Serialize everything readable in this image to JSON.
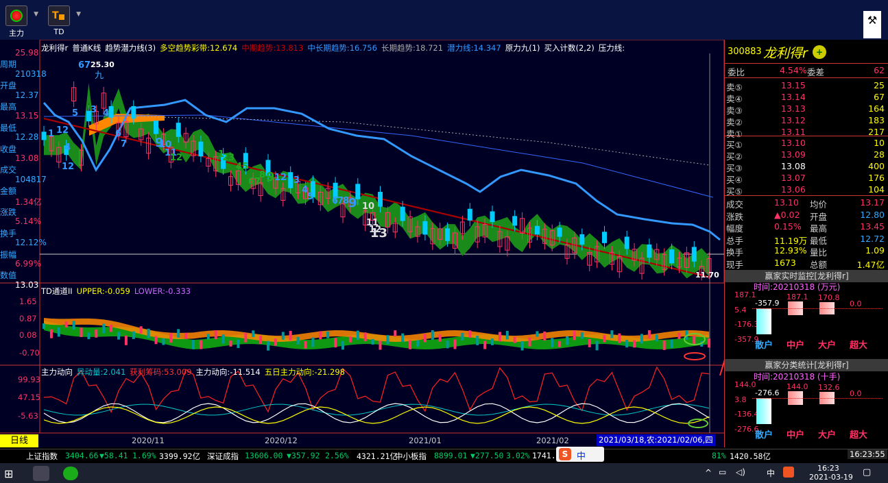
{
  "toolbar": {
    "btn1": "主力",
    "btn2": "TD"
  },
  "legend_main": [
    {
      "t": "龙利得r",
      "c": "#fff"
    },
    {
      "t": "普通K线",
      "c": "#fff"
    },
    {
      "t": "趋势潜力线(3)",
      "c": "#fff"
    },
    {
      "t": "多空趋势彩带:12.674",
      "c": "#ff0"
    },
    {
      "t": "中期趋势:13.813",
      "c": "#c00"
    },
    {
      "t": "中长期趋势:16.756",
      "c": "#39f"
    },
    {
      "t": "长期趋势:18.721",
      "c": "#aaa"
    },
    {
      "t": "潜力线:14.347",
      "c": "#39f"
    },
    {
      "t": "原力九(1)",
      "c": "#fff"
    },
    {
      "t": "买入计数(2,2)",
      "c": "#fff"
    },
    {
      "t": "压力线:",
      "c": "#fff"
    }
  ],
  "legend_td": [
    {
      "t": "TD通道II",
      "c": "#fff"
    },
    {
      "t": "UPPER:-0.059",
      "c": "#ff0"
    },
    {
      "t": "LOWER:-0.333",
      "c": "#c6f"
    }
  ],
  "legend_zl": [
    {
      "t": "主力动向",
      "c": "#fff"
    },
    {
      "t": "异动量:2.041",
      "c": "#0cc"
    },
    {
      "t": "获利筹码:53.009",
      "c": "#f33"
    },
    {
      "t": "主力动向:-11.514",
      "c": "#fff"
    },
    {
      "t": "五日主力动向:-21.298",
      "c": "#ff0"
    }
  ],
  "left_labels": [
    {
      "t": "25.98",
      "c": "#f36"
    },
    {
      "t": "周期",
      "c": "#3af"
    },
    {
      "t": "210318",
      "c": "#3af"
    },
    {
      "t": "开盘",
      "c": "#3af"
    },
    {
      "t": "12.37",
      "c": "#3af"
    },
    {
      "t": "最高",
      "c": "#3af"
    },
    {
      "t": "13.15",
      "c": "#f36"
    },
    {
      "t": "最低",
      "c": "#3af"
    },
    {
      "t": "12.28",
      "c": "#3af"
    },
    {
      "t": "收盘",
      "c": "#3af"
    },
    {
      "t": "13.08",
      "c": "#f36"
    },
    {
      "t": "成交",
      "c": "#3af"
    },
    {
      "t": "104817",
      "c": "#3af"
    },
    {
      "t": "金额",
      "c": "#3af"
    },
    {
      "t": "1.34亿",
      "c": "#f36"
    },
    {
      "t": "涨跌",
      "c": "#3af"
    },
    {
      "t": "5.14%",
      "c": "#f36"
    },
    {
      "t": "换手",
      "c": "#3af"
    },
    {
      "t": "12.12%",
      "c": "#3af"
    },
    {
      "t": "振幅",
      "c": "#3af"
    },
    {
      "t": "6.99%",
      "c": "#f36"
    },
    {
      "t": "数值",
      "c": "#3af"
    },
    {
      "t": "13.03",
      "c": "#fff"
    }
  ],
  "td_ticks": [
    "1.65",
    "0.87",
    "0.08",
    "-0.70"
  ],
  "zl_ticks": [
    "99.93",
    "47.15",
    "-5.63"
  ],
  "dates": [
    "2020/11",
    "2020/12",
    "2021/01",
    "2021/02"
  ],
  "period": "日线",
  "status_date": "2021/03/18,农:2021/02/06,四",
  "annotations": {
    "high": "25.30",
    "low": "11.70",
    "nine": "九"
  },
  "count_labels": [
    "67",
    "5",
    "3",
    "4",
    "6",
    "7",
    "12",
    "1",
    "4",
    "12",
    "9",
    "10",
    "11",
    "12",
    "1",
    "23",
    "45",
    "67",
    "8",
    "9",
    "12",
    "3",
    "4",
    "5",
    "6",
    "7",
    "8",
    "9",
    "10",
    "11",
    "12",
    "13"
  ],
  "quote": {
    "code": "300883",
    "name": "龙利得r",
    "wb_label": "委比",
    "wb_val": "4.54%",
    "wc_label": "委差",
    "wc_val": "62",
    "sells": [
      {
        "l": "卖⑤",
        "p": "13.15",
        "v": "25"
      },
      {
        "l": "卖④",
        "p": "13.14",
        "v": "67"
      },
      {
        "l": "卖③",
        "p": "13.13",
        "v": "164"
      },
      {
        "l": "卖②",
        "p": "13.12",
        "v": "183"
      },
      {
        "l": "卖①",
        "p": "13.11",
        "v": "217"
      }
    ],
    "buys": [
      {
        "l": "买①",
        "p": "13.10",
        "v": "10"
      },
      {
        "l": "买②",
        "p": "13.09",
        "v": "28"
      },
      {
        "l": "买③",
        "p": "13.08",
        "v": "400"
      },
      {
        "l": "买④",
        "p": "13.07",
        "v": "176"
      },
      {
        "l": "买⑤",
        "p": "13.06",
        "v": "104"
      }
    ],
    "stats": [
      {
        "a": "成交",
        "av": "13.10",
        "b": "均价",
        "bv": "13.17",
        "ac": "#f36",
        "bc": "#f36"
      },
      {
        "a": "涨跌",
        "av": "▲0.02",
        "b": "开盘",
        "bv": "12.80",
        "ac": "#f36",
        "bc": "#3af"
      },
      {
        "a": "幅度",
        "av": "0.15%",
        "b": "最高",
        "bv": "13.45",
        "ac": "#f36",
        "bc": "#f36"
      },
      {
        "a": "总手",
        "av": "11.19万",
        "b": "最低",
        "bv": "12.72",
        "ac": "#ff0",
        "bc": "#3af"
      },
      {
        "a": "换手",
        "av": "12.93%",
        "b": "量比",
        "bv": "1.09",
        "ac": "#ff0",
        "bc": "#ff0"
      },
      {
        "a": "现手",
        "av": "1673",
        "b": "总额",
        "bv": "1.47亿",
        "ac": "#ff0",
        "bc": "#ff0"
      }
    ]
  },
  "monitor1": {
    "title": "赢家实时监控[龙利得r]",
    "time": "时间:20210318 (万元)",
    "ticks": [
      "187.1",
      "5.4",
      "-176.3",
      "-357.9"
    ],
    "bars": [
      {
        "l": "散户",
        "v": "-357.9"
      },
      {
        "l": "中户",
        "v": "187.1"
      },
      {
        "l": "大户",
        "v": "170.8"
      },
      {
        "l": "超大",
        "v": "0.0"
      }
    ]
  },
  "monitor2": {
    "title": "赢家分类统计[龙利得r]",
    "time": "时间:20210318 (十手)",
    "ticks": [
      "144.0",
      "3.8",
      "-136.4",
      "-276.6"
    ],
    "bars": [
      {
        "l": "散户",
        "v": "-276.6"
      },
      {
        "l": "中户",
        "v": "144.0"
      },
      {
        "l": "大户",
        "v": "132.6"
      },
      {
        "l": "超大",
        "v": "0.0"
      }
    ]
  },
  "index_bar": [
    {
      "t": "上证指数",
      "c": "#fff"
    },
    {
      "t": "3404.66",
      "c": "#0c6"
    },
    {
      "t": "▼58.41",
      "c": "#0c6"
    },
    {
      "t": "1.69%",
      "c": "#0c6"
    },
    {
      "t": "3399.92亿",
      "c": "#fff"
    },
    {
      "t": "深证成指",
      "c": "#fff"
    },
    {
      "t": "13606.00",
      "c": "#0c6"
    },
    {
      "t": "▼357.92",
      "c": "#0c6"
    },
    {
      "t": "2.56%",
      "c": "#0c6"
    },
    {
      "t": "4321.21亿",
      "c": "#fff"
    },
    {
      "t": "中小板指",
      "c": "#fff"
    },
    {
      "t": "8899.01",
      "c": "#0c6"
    },
    {
      "t": "▼277.50",
      "c": "#0c6"
    },
    {
      "t": "3.02%",
      "c": "#0c6"
    },
    {
      "t": "1741.6",
      "c": "#fff"
    },
    {
      "t": "81%",
      "c": "#0c6"
    },
    {
      "t": "1420.58亿",
      "c": "#fff"
    }
  ],
  "clock": "16:23:55",
  "ime": "中",
  "taskbar": {
    "time": "16:23",
    "date": "2021-03-19",
    "ime": "中"
  }
}
